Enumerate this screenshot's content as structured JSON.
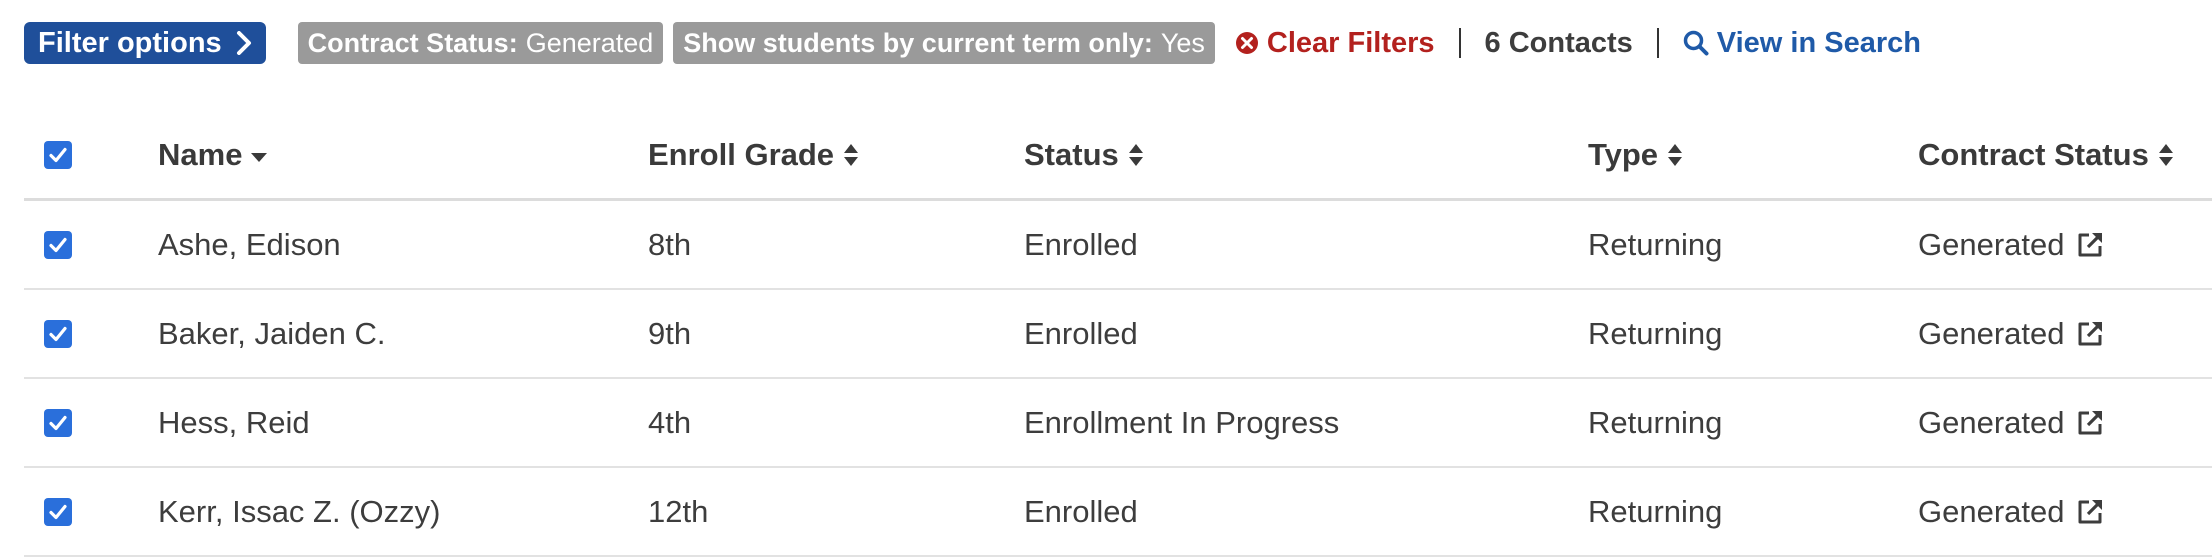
{
  "toolbar": {
    "filter_button": "Filter options",
    "chips": [
      {
        "key": "Contract Status:",
        "value": "Generated"
      },
      {
        "key": "Show students by current term only:",
        "value": "Yes"
      }
    ],
    "clear_filters": "Clear Filters",
    "contacts_count": "6 Contacts",
    "view_in_search": "View in Search"
  },
  "table": {
    "columns": [
      "Name",
      "Enroll Grade",
      "Status",
      "Type",
      "Contract Status"
    ],
    "rows": [
      {
        "name": "Ashe, Edison",
        "grade": "8th",
        "status": "Enrolled",
        "type": "Returning",
        "contract": "Generated"
      },
      {
        "name": "Baker, Jaiden C.",
        "grade": "9th",
        "status": "Enrolled",
        "type": "Returning",
        "contract": "Generated"
      },
      {
        "name": "Hess, Reid",
        "grade": "4th",
        "status": "Enrollment In Progress",
        "type": "Returning",
        "contract": "Generated"
      },
      {
        "name": "Kerr, Issac Z. (Ozzy)",
        "grade": "12th",
        "status": "Enrolled",
        "type": "Returning",
        "contract": "Generated"
      }
    ]
  },
  "colors": {
    "primary": "#1f4f9a",
    "chip": "#9a9a9a",
    "danger": "#b3211e",
    "link": "#1f5aa8",
    "checkbox": "#2a6fdb"
  }
}
